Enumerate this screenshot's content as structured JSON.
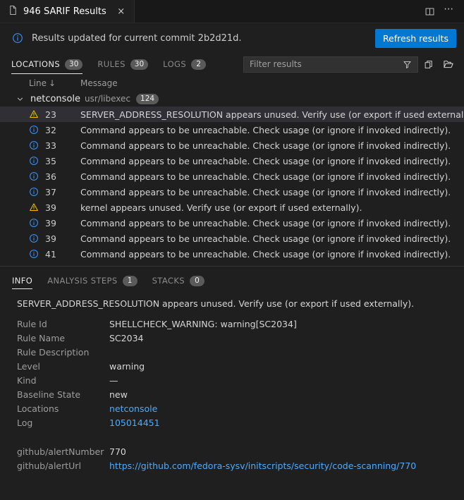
{
  "tab": {
    "icon": "file-icon",
    "title": "946 SARIF Results",
    "close": "×",
    "split_icon": "split-editor-icon",
    "more_icon": "more-actions-icon"
  },
  "banner": {
    "icon": "info-icon",
    "message": "Results updated for current commit 2b2d21d.",
    "button_label": "Refresh results",
    "button_color": "#0078d4"
  },
  "toolbar": {
    "tabs": [
      {
        "label": "LOCATIONS",
        "count": "30",
        "active": true
      },
      {
        "label": "RULES",
        "count": "30",
        "active": false
      },
      {
        "label": "LOGS",
        "count": "2",
        "active": false
      }
    ],
    "filter_placeholder": "Filter results",
    "filter_value": "",
    "funnel_icon": "filter-funnel-icon",
    "copy_icon": "copy-results-icon",
    "folder_icon": "open-folder-icon"
  },
  "list": {
    "columns": {
      "line": "Line",
      "sort_arrow": "↓",
      "message": "Message"
    },
    "group": {
      "chevron": "chevron-down-icon",
      "name": "netconsole",
      "path": "usr/libexec",
      "count": "124"
    },
    "rows": [
      {
        "severity": "warning",
        "line": "23",
        "message": "SERVER_ADDRESS_RESOLUTION appears unused. Verify use (or export if used externally).",
        "selected": true
      },
      {
        "severity": "info",
        "line": "32",
        "message": "Command appears to be unreachable. Check usage (or ignore if invoked indirectly).",
        "selected": false
      },
      {
        "severity": "info",
        "line": "33",
        "message": "Command appears to be unreachable. Check usage (or ignore if invoked indirectly).",
        "selected": false
      },
      {
        "severity": "info",
        "line": "35",
        "message": "Command appears to be unreachable. Check usage (or ignore if invoked indirectly).",
        "selected": false
      },
      {
        "severity": "info",
        "line": "36",
        "message": "Command appears to be unreachable. Check usage (or ignore if invoked indirectly).",
        "selected": false
      },
      {
        "severity": "info",
        "line": "37",
        "message": "Command appears to be unreachable. Check usage (or ignore if invoked indirectly).",
        "selected": false
      },
      {
        "severity": "warning",
        "line": "39",
        "message": "kernel appears unused. Verify use (or export if used externally).",
        "selected": false
      },
      {
        "severity": "info",
        "line": "39",
        "message": "Command appears to be unreachable. Check usage (or ignore if invoked indirectly).",
        "selected": false
      },
      {
        "severity": "info",
        "line": "39",
        "message": "Command appears to be unreachable. Check usage (or ignore if invoked indirectly).",
        "selected": false
      },
      {
        "severity": "info",
        "line": "41",
        "message": "Command appears to be unreachable. Check usage (or ignore if invoked indirectly).",
        "selected": false
      }
    ]
  },
  "details": {
    "tabs": [
      {
        "label": "INFO",
        "count": null,
        "active": true
      },
      {
        "label": "ANALYSIS STEPS",
        "count": "1",
        "active": false
      },
      {
        "label": "STACKS",
        "count": "0",
        "active": false
      }
    ],
    "message": "SERVER_ADDRESS_RESOLUTION appears unused. Verify use (or export if used externally).",
    "fields": [
      {
        "key": "Rule Id",
        "value": "SHELLCHECK_WARNING: warning[SC2034]",
        "link": false
      },
      {
        "key": "Rule Name",
        "value": "SC2034",
        "link": false
      },
      {
        "key": "Rule Description",
        "value": "",
        "link": false
      },
      {
        "key": "Level",
        "value": "warning",
        "link": false
      },
      {
        "key": "Kind",
        "value": "—",
        "link": false
      },
      {
        "key": "Baseline State",
        "value": "new",
        "link": false
      },
      {
        "key": "Locations",
        "value": "netconsole",
        "link": true
      },
      {
        "key": "Log",
        "value": "105014451",
        "link": true
      }
    ],
    "properties": [
      {
        "key": "github/alertNumber",
        "value": "770",
        "link": false
      },
      {
        "key": "github/alertUrl",
        "value": "https://github.com/fedora-sysv/initscripts/security/code-scanning/770",
        "link": true
      }
    ]
  },
  "colors": {
    "warning": "#f0c000",
    "info": "#3794ff",
    "link": "#4daafc",
    "accent": "#0078d4"
  }
}
